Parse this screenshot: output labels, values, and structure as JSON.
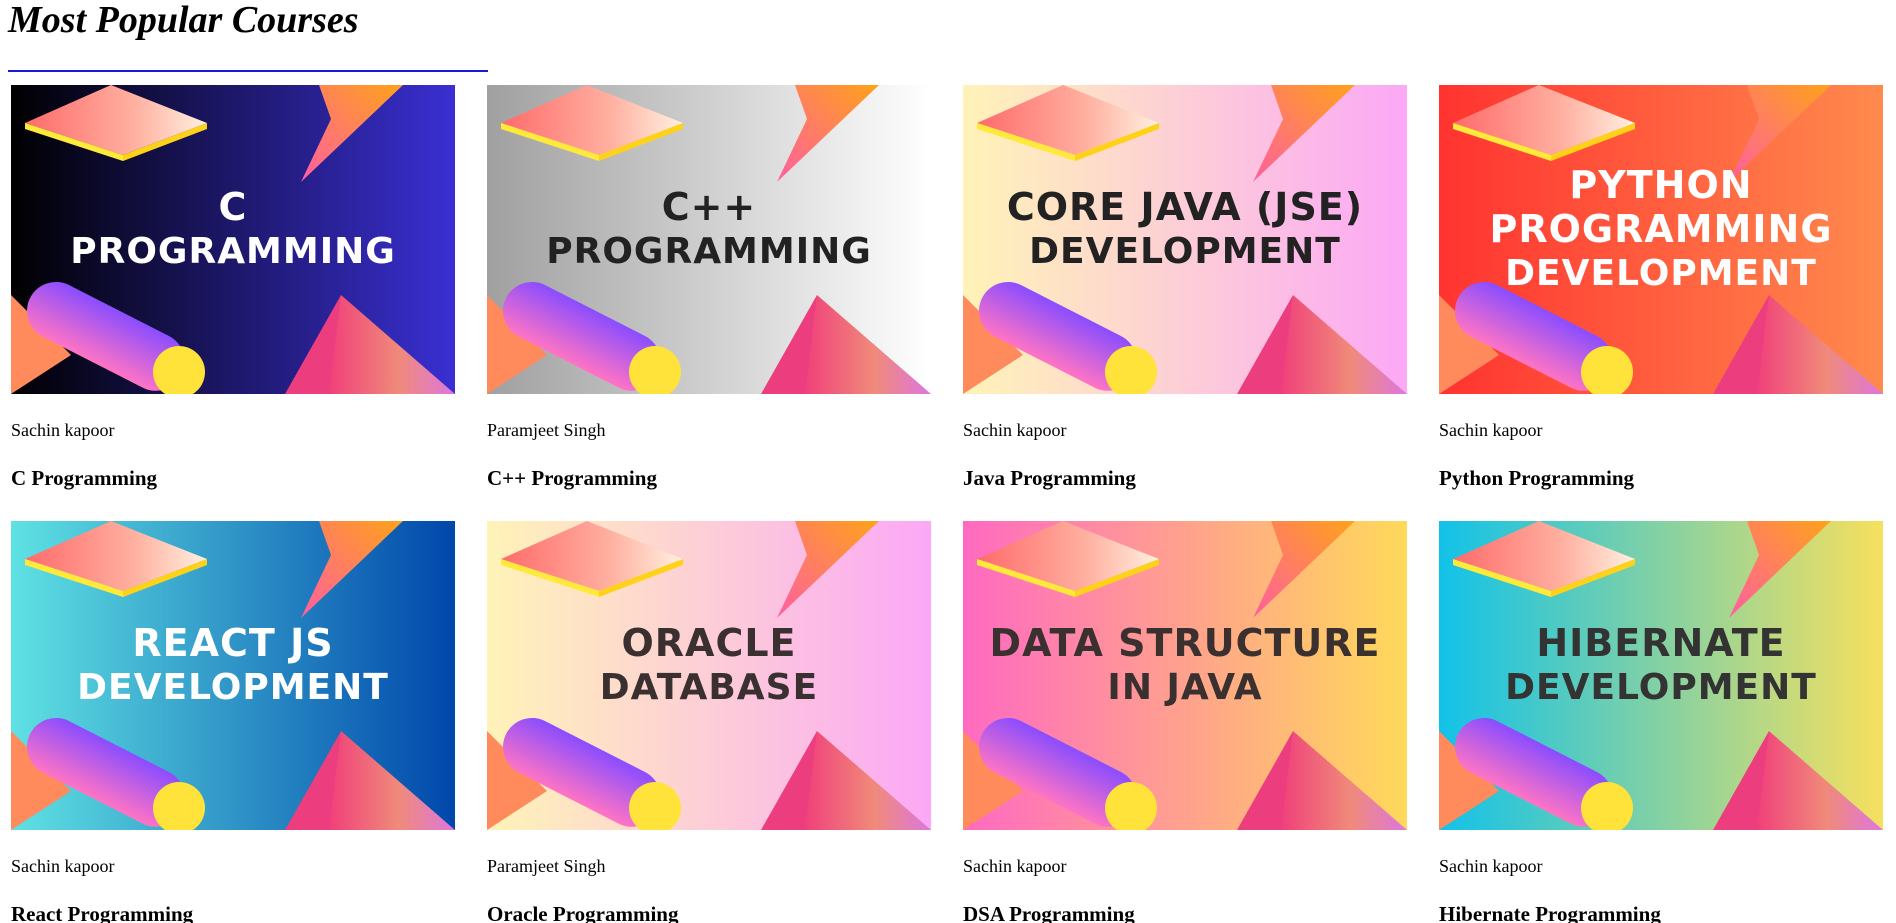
{
  "section": {
    "title": "Most Popular Courses",
    "underline_color": "#1a1ad6"
  },
  "courses": [
    {
      "thumb_line1": "C",
      "thumb_line2": "PROGRAMMING",
      "text_color": "#ffffff",
      "bg_from": "#000000",
      "bg_to": "#3a2fd3",
      "author": "Sachin kapoor",
      "name": "C Programming"
    },
    {
      "thumb_line1": "C++",
      "thumb_line2": "PROGRAMMING",
      "text_color": "#222222",
      "bg_from": "#a0a0a0",
      "bg_to": "#ffffff",
      "author": "Paramjeet Singh",
      "name": "C++ Programming"
    },
    {
      "thumb_line1": "CORE JAVA (JSE)",
      "thumb_line2": "DEVELOPMENT",
      "text_color": "#222222",
      "bg_from": "#fff3b8",
      "bg_to": "#fba8f6",
      "author": "Sachin kapoor",
      "name": "Java Programming"
    },
    {
      "thumb_line1": "PYTHON PROGRAMMING",
      "thumb_line2": "DEVELOPMENT",
      "text_color": "#ffffff",
      "bg_from": "#ff3330",
      "bg_to": "#ff8a4d",
      "author": "Sachin kapoor",
      "name": "Python Programming"
    },
    {
      "thumb_line1": "REACT JS",
      "thumb_line2": "DEVELOPMENT",
      "text_color": "#ffffff",
      "bg_from": "#5fe2e3",
      "bg_to": "#0047ab",
      "author": "Sachin kapoor",
      "name": "React Programming"
    },
    {
      "thumb_line1": "ORACLE",
      "thumb_line2": "DATABASE",
      "text_color": "#3a3030",
      "bg_from": "#fff3b8",
      "bg_to": "#fba8f6",
      "author": "Paramjeet Singh",
      "name": "Oracle Programming"
    },
    {
      "thumb_line1": "DATA STRUCTURE",
      "thumb_line2": "IN JAVA",
      "text_color": "#3a3030",
      "bg_from": "#ff6ac1",
      "bg_to": "#ffd95a",
      "author": "Sachin kapoor",
      "name": "DSA Programming"
    },
    {
      "thumb_line1": "HIBERNATE",
      "thumb_line2": "DEVELOPMENT",
      "text_color": "#333333",
      "bg_from": "#12c2e9",
      "bg_to": "#f6e05e",
      "author": "Sachin kapoor",
      "name": "Hibernate Programming"
    }
  ]
}
